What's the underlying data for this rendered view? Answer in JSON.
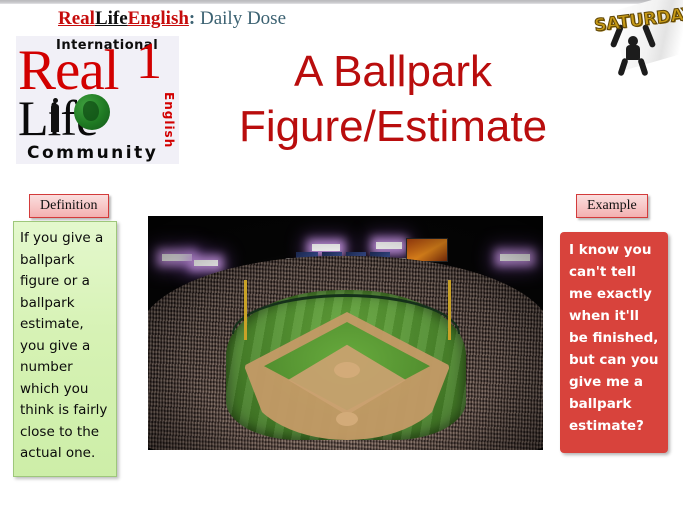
{
  "header": {
    "brand_real": "Real",
    "brand_life": "Life",
    "brand_english": "English",
    "colon": ":",
    "tail": " Daily Dose"
  },
  "logo": {
    "international": "International",
    "real": "Real",
    "one": "1",
    "life": "Life",
    "english_vertical": "English",
    "community": "Community"
  },
  "title": {
    "line1": "A Ballpark",
    "line2": "Figure/Estimate"
  },
  "day_badge": {
    "label": "SATURDAY",
    "color": "#c79a16"
  },
  "definition": {
    "badge_label": "Definition",
    "text": "If you give a ballpark figure or a ballpark estimate, you give a number which you think is fairly close to the actual one.",
    "background": "#d6f2b4",
    "border": "#9ec77b"
  },
  "example": {
    "badge_label": "Example",
    "text": "I know you can't tell me exactly when it'll be finished, but can you give me a ballpark estimate?",
    "background": "#d8433c",
    "text_color": "#ffffff"
  },
  "photo": {
    "alt": "night baseball stadium packed with crowd"
  },
  "colors": {
    "title_red": "#b90d0d",
    "brand_red": "#c60c0c",
    "header_slate": "#3c6272",
    "badge_pink": "#f7c6c6",
    "badge_border": "#d33b3b"
  }
}
